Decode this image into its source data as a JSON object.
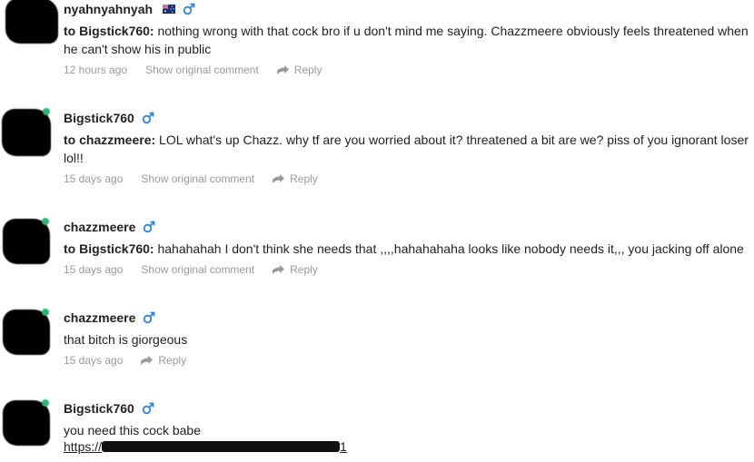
{
  "comments": [
    {
      "username": "nyahnyahnyah",
      "to_label": "to Bigstick760:",
      "body": "nothing wrong with that cock bro if u don't mind me saying. Chazzmeere obviously feels threatened when he can't show his in public",
      "time": "12 hours ago",
      "show_original": "Show original comment",
      "reply": "Reply"
    },
    {
      "username": "Bigstick760",
      "to_label": "to chazzmeere:",
      "body": "LOL what's up Chazz. why tf are you worried about it? threatened a bit are we? piss of you ignorant loser lol!!",
      "time": "15 days ago",
      "show_original": "Show original comment",
      "reply": "Reply"
    },
    {
      "username": "chazzmeere",
      "to_label": "to Bigstick760:",
      "body": "hahahahah I don't think she needs that ,,,,hahahahaha looks like nobody needs it,,, you jacking off alone",
      "time": "15 days ago",
      "show_original": "Show original comment",
      "reply": "Reply"
    },
    {
      "username": "chazzmeere",
      "body": "that bitch is giorgeous",
      "time": "15 days ago",
      "reply": "Reply"
    },
    {
      "username": "Bigstick760",
      "body": "you need this cock babe",
      "link_prefix": "https://",
      "link_suffix": "1"
    }
  ],
  "colors": {
    "text": "#222222",
    "meta": "#999999",
    "gender_icon": "#2e86de",
    "online_dot": "#2bb673"
  },
  "icons": {
    "gender": "male-symbol-icon",
    "flag": "australia-flag-icon",
    "reply": "reply-arrow-icon"
  }
}
